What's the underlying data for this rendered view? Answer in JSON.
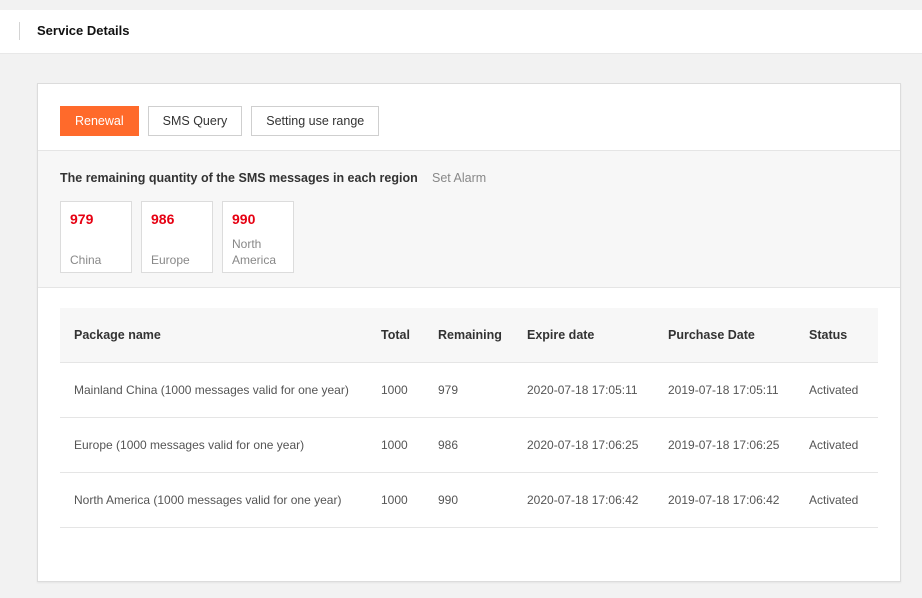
{
  "header": {
    "title": "Service Details"
  },
  "toolbar": {
    "renewal_label": "Renewal",
    "sms_query_label": "SMS Query",
    "setting_label": "Setting use range"
  },
  "regions": {
    "title": "The remaining quantity of the SMS messages in each region",
    "set_alarm": "Set Alarm",
    "items": [
      {
        "count": "979",
        "name": "China"
      },
      {
        "count": "986",
        "name": "Europe"
      },
      {
        "count": "990",
        "name": "North America"
      }
    ]
  },
  "table": {
    "columns": [
      "Package name",
      "Total",
      "Remaining",
      "Expire date",
      "Purchase Date",
      "Status"
    ],
    "rows": [
      {
        "package": "Mainland China (1000 messages valid for one year)",
        "total": "1000",
        "remaining": "979",
        "expire": "2020-07-18 17:05:11",
        "purchase": "2019-07-18 17:05:11",
        "status": "Activated"
      },
      {
        "package": "Europe (1000 messages valid for one year)",
        "total": "1000",
        "remaining": "986",
        "expire": "2020-07-18 17:06:25",
        "purchase": "2019-07-18 17:06:25",
        "status": "Activated"
      },
      {
        "package": "North America (1000 messages valid for one year)",
        "total": "1000",
        "remaining": "990",
        "expire": "2020-07-18 17:06:42",
        "purchase": "2019-07-18 17:06:42",
        "status": "Activated"
      }
    ]
  },
  "colors": {
    "primary": "#ff6a2b",
    "count": "#e60012",
    "status_active": "#1aa34a"
  }
}
